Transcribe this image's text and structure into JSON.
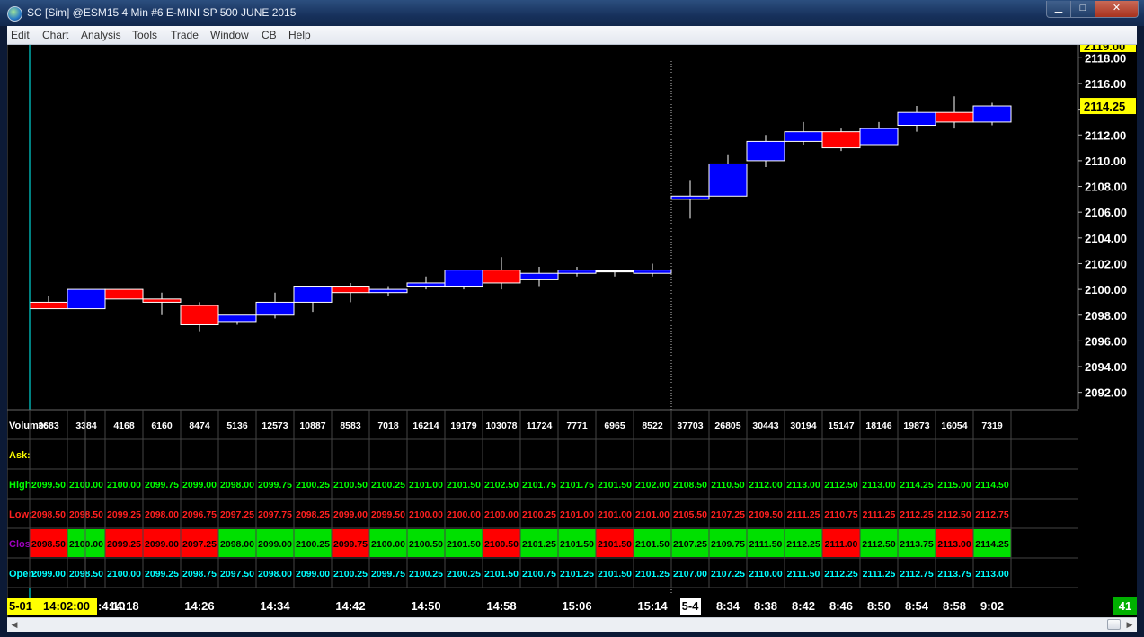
{
  "window": {
    "title": "SC [Sim] @ESM15  4 Min   #6  E-MINI SP 500 JUNE 2015",
    "minimize_glyph": "▁",
    "maximize_glyph": "□",
    "close_glyph": "✕"
  },
  "menu": [
    "Edit",
    "Chart",
    "Analysis",
    "Tools",
    "Trade",
    "Window",
    "CB",
    "Help"
  ],
  "price_axis": {
    "ticks": [
      "2118.00",
      "2116.00",
      "2114.00",
      "2112.00",
      "2110.00",
      "2108.00",
      "2106.00",
      "2104.00",
      "2102.00",
      "2100.00",
      "2098.00",
      "2096.00",
      "2094.00",
      "2092.00"
    ],
    "top_partial_label": "2119.00",
    "current_price": "2114.25"
  },
  "table": {
    "row_labels": {
      "volume": "Volume:",
      "ask": "Ask:",
      "high": "High:",
      "low": "Low:",
      "close": "Close:",
      "open": "Open:"
    },
    "volume": [
      "3683",
      "3384",
      "4168",
      "6160",
      "8474",
      "5136",
      "12573",
      "10887",
      "8583",
      "7018",
      "16214",
      "19179",
      "103078",
      "11724",
      "7771",
      "6965",
      "8522",
      "37703",
      "26805",
      "30443",
      "30194",
      "15147",
      "18146",
      "19873",
      "16054",
      "7319"
    ],
    "high": [
      "2099.50",
      "2100.00",
      "2100.00",
      "2099.75",
      "2099.00",
      "2098.00",
      "2099.75",
      "2100.25",
      "2100.50",
      "2100.25",
      "2101.00",
      "2101.50",
      "2102.50",
      "2101.75",
      "2101.75",
      "2101.50",
      "2102.00",
      "2108.50",
      "2110.50",
      "2112.00",
      "2113.00",
      "2112.50",
      "2113.00",
      "2114.25",
      "2115.00",
      "2114.50"
    ],
    "low": [
      "2098.50",
      "2098.50",
      "2099.25",
      "2098.00",
      "2096.75",
      "2097.25",
      "2097.75",
      "2098.25",
      "2099.00",
      "2099.50",
      "2100.00",
      "2100.00",
      "2100.00",
      "2100.25",
      "2101.00",
      "2101.00",
      "2101.00",
      "2105.50",
      "2107.25",
      "2109.50",
      "2111.25",
      "2110.75",
      "2111.25",
      "2112.25",
      "2112.50",
      "2112.75"
    ],
    "close": [
      "2098.50",
      "2100.00",
      "2099.25",
      "2099.00",
      "2097.25",
      "2098.00",
      "2099.00",
      "2100.25",
      "2099.75",
      "2100.00",
      "2100.50",
      "2101.50",
      "2100.50",
      "2101.25",
      "2101.50",
      "2101.50",
      "2101.50",
      "2107.25",
      "2109.75",
      "2111.50",
      "2112.25",
      "2111.00",
      "2112.50",
      "2113.75",
      "2113.00",
      "2114.25"
    ],
    "open": [
      "2099.00",
      "2098.50",
      "2100.00",
      "2099.25",
      "2098.75",
      "2097.50",
      "2098.00",
      "2099.00",
      "2100.25",
      "2099.75",
      "2100.25",
      "2100.25",
      "2101.50",
      "2100.75",
      "2101.25",
      "2101.50",
      "2101.25",
      "2107.00",
      "2107.25",
      "2110.00",
      "2111.50",
      "2112.25",
      "2111.25",
      "2112.75",
      "2113.75",
      "2113.00"
    ]
  },
  "time_axis": {
    "cursor_date": "5-01",
    "cursor_time": "14:02:00",
    "partial_label": ":4:10",
    "labels": [
      "14:18",
      "14:26",
      "14:34",
      "14:42",
      "14:50",
      "14:58",
      "15:06",
      "15:14",
      "5-4",
      "8:34",
      "8:38",
      "8:42",
      "8:46",
      "8:50",
      "8:54",
      "8:58",
      "9:02"
    ],
    "bar_count": "41"
  },
  "colors": {
    "up_candle": "#0000ff",
    "down_candle": "#ff0000",
    "neutral_candle": "#ffffff",
    "high_text": "#00ff00",
    "low_text": "#ff2020",
    "close_label": "#a000c0",
    "open_text": "#00ffff",
    "ask_label": "#ffff00",
    "price_highlight": "#ffff00",
    "cursor_line": "#00ffff",
    "count_box": "#00b000"
  },
  "chart_data": {
    "type": "candlestick",
    "title": "E-MINI SP 500 JUNE 2015",
    "xlabel": "",
    "ylabel": "",
    "y_range": [
      2091,
      2119
    ],
    "categories": [
      "",
      "",
      "",
      "",
      "",
      "",
      "",
      "",
      "",
      "",
      "",
      "",
      "",
      "",
      "",
      "",
      "",
      "",
      "",
      "",
      "",
      "",
      "",
      "",
      "",
      ""
    ],
    "open": [
      2099.0,
      2098.5,
      2100.0,
      2099.25,
      2098.75,
      2097.5,
      2098.0,
      2099.0,
      2100.25,
      2099.75,
      2100.25,
      2100.25,
      2101.5,
      2100.75,
      2101.25,
      2101.5,
      2101.25,
      2107.0,
      2107.25,
      2110.0,
      2111.5,
      2112.25,
      2111.25,
      2112.75,
      2113.75,
      2113.0
    ],
    "high": [
      2099.5,
      2100.0,
      2100.0,
      2099.75,
      2099.0,
      2098.0,
      2099.75,
      2100.25,
      2100.5,
      2100.25,
      2101.0,
      2101.5,
      2102.5,
      2101.75,
      2101.75,
      2101.5,
      2102.0,
      2108.5,
      2110.5,
      2112.0,
      2113.0,
      2112.5,
      2113.0,
      2114.25,
      2115.0,
      2114.5
    ],
    "low": [
      2098.5,
      2098.5,
      2099.25,
      2098.0,
      2096.75,
      2097.25,
      2097.75,
      2098.25,
      2099.0,
      2099.5,
      2100.0,
      2100.0,
      2100.0,
      2100.25,
      2101.0,
      2101.0,
      2101.0,
      2105.5,
      2107.25,
      2109.5,
      2111.25,
      2110.75,
      2111.25,
      2112.25,
      2112.5,
      2112.75
    ],
    "close": [
      2098.5,
      2100.0,
      2099.25,
      2099.0,
      2097.25,
      2098.0,
      2099.0,
      2100.25,
      2099.75,
      2100.0,
      2100.5,
      2101.5,
      2100.5,
      2101.25,
      2101.5,
      2101.5,
      2101.5,
      2107.25,
      2109.75,
      2111.5,
      2112.25,
      2111.0,
      2112.5,
      2113.75,
      2113.0,
      2114.25
    ],
    "volume": [
      3683,
      3384,
      4168,
      6160,
      8474,
      5136,
      12573,
      10887,
      8583,
      7018,
      16214,
      19179,
      103078,
      11724,
      7771,
      6965,
      8522,
      37703,
      26805,
      30443,
      30194,
      15147,
      18146,
      19873,
      16054,
      7319
    ]
  }
}
